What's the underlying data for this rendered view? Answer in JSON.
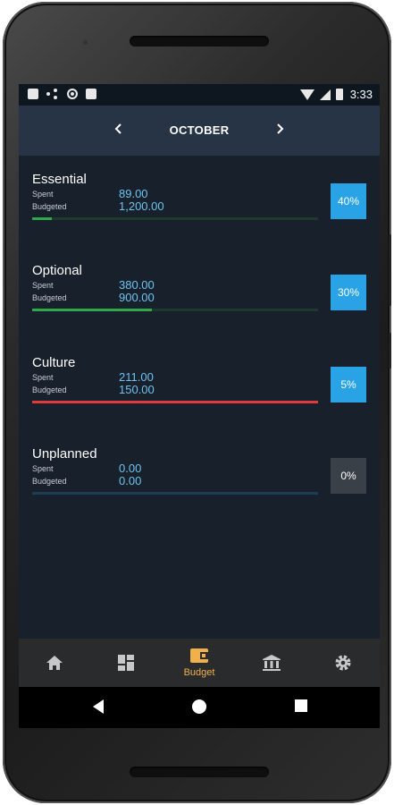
{
  "status_bar": {
    "time": "3:33"
  },
  "header": {
    "month": "OCTOBER",
    "prev_icon": "chevron-left-icon",
    "next_icon": "chevron-right-icon"
  },
  "labels": {
    "spent": "Spent",
    "budgeted": "Budgeted"
  },
  "categories": [
    {
      "name": "Essential",
      "spent": "89.00",
      "budgeted": "1,200.00",
      "percent": "40%",
      "progress": 0.07,
      "bar_color": "#2fa84a",
      "track_color": "#1e3a2a",
      "badge_color": "#2aa3e6"
    },
    {
      "name": "Optional",
      "spent": "380.00",
      "budgeted": "900.00",
      "percent": "30%",
      "progress": 0.42,
      "bar_color": "#2fa84a",
      "track_color": "#1e3a2a",
      "badge_color": "#2aa3e6"
    },
    {
      "name": "Culture",
      "spent": "211.00",
      "budgeted": "150.00",
      "percent": "5%",
      "progress": 1.0,
      "bar_color": "#e03a3a",
      "track_color": "#1e3a2a",
      "badge_color": "#2aa3e6"
    },
    {
      "name": "Unplanned",
      "spent": "0.00",
      "budgeted": "0.00",
      "percent": "0%",
      "progress": 0.0,
      "bar_color": "#1d5a85",
      "track_color": "#1d3d55",
      "badge_color": "#3a4048"
    }
  ],
  "bottom_nav": {
    "items": [
      {
        "icon": "home-icon",
        "label": ""
      },
      {
        "icon": "dashboard-icon",
        "label": ""
      },
      {
        "icon": "wallet-icon",
        "label": "Budget",
        "active": true
      },
      {
        "icon": "bank-icon",
        "label": ""
      },
      {
        "icon": "gear-icon",
        "label": ""
      }
    ]
  },
  "colors": {
    "accent": "#2aa3e6",
    "active_tab": "#f0b04c",
    "background": "#17202b",
    "header": "#263445"
  }
}
